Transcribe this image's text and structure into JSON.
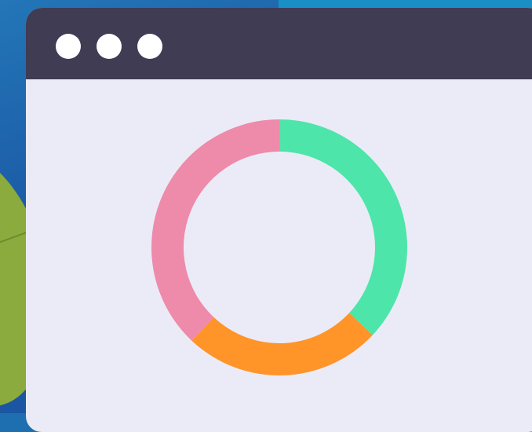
{
  "window": {
    "controls": [
      "close",
      "minimize",
      "maximize"
    ]
  },
  "colors": {
    "titlebar": "#3f3c54",
    "content_bg": "#ebebf7",
    "window_dot": "#ffffff",
    "leaf": "#8bab3f"
  },
  "chart_data": {
    "type": "pie",
    "style": "donut",
    "slices": [
      {
        "value": 37,
        "color": "#4de5a9"
      },
      {
        "value": 25,
        "color": "#ff9429"
      },
      {
        "value": 38,
        "color": "#ee8aaa"
      }
    ]
  }
}
